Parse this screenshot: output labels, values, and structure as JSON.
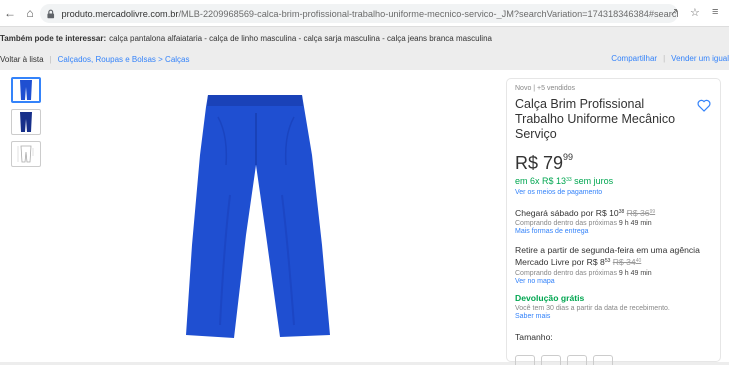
{
  "browser": {
    "url_host": "produto.mercadolivre.com.br",
    "url_path": "/MLB-2209968569-calca-brim-profissional-trabalho-uniforme-mecnico-servico-_JM?searchVariation=174318346384#searchVaria..."
  },
  "suggestions": {
    "label": "Também pode te interessar:",
    "items": "calça pantalona alfaiataria - calça de linho masculina - calça sarja masculina - calça jeans branca masculina"
  },
  "breadcrumb": {
    "back": "Voltar à lista",
    "path": "Calçados, Roupas e Bolsas > Calças",
    "share": "Compartilhar",
    "sell": "Vender um igual"
  },
  "product": {
    "condition": "Novo  |  +5 vendidos",
    "title": "Calça Brim Profissional Trabalho Uniforme Mecânico Serviço",
    "price_int": "R$ 79",
    "price_cents": "99",
    "installments_prefix": "em",
    "installments_value": "6x R$ 13",
    "installments_cents": "33",
    "installments_suffix": "sem juros",
    "payment_link": "Ver os meios de pagamento",
    "shipping_text": "Chegará sábado por R$ 10",
    "shipping_cents": "38",
    "shipping_old": "R$ 36",
    "shipping_old_cents": "99",
    "shipping_note_prefix": "Comprando dentro das próximas",
    "shipping_note_time": "9 h 49 min",
    "shipping_link": "Mais formas de entrega",
    "pickup_text": "Retire a partir de segunda-feira em uma agência Mercado Livre por R$ 8",
    "pickup_cents": "53",
    "pickup_old": "R$ 34",
    "pickup_old_cents": "40",
    "pickup_note_prefix": "Comprando dentro das próximas",
    "pickup_note_time": "9 h 49 min",
    "pickup_link": "Ver no mapa",
    "return_title": "Devolução grátis",
    "return_note": "Você tem 30 dias a partir da data de recebimento.",
    "return_link": "Saber mais",
    "size_label": "Tamanho:"
  },
  "colors": {
    "link": "#3483fa",
    "green": "#00a650",
    "pants": "#1f4fd1"
  }
}
